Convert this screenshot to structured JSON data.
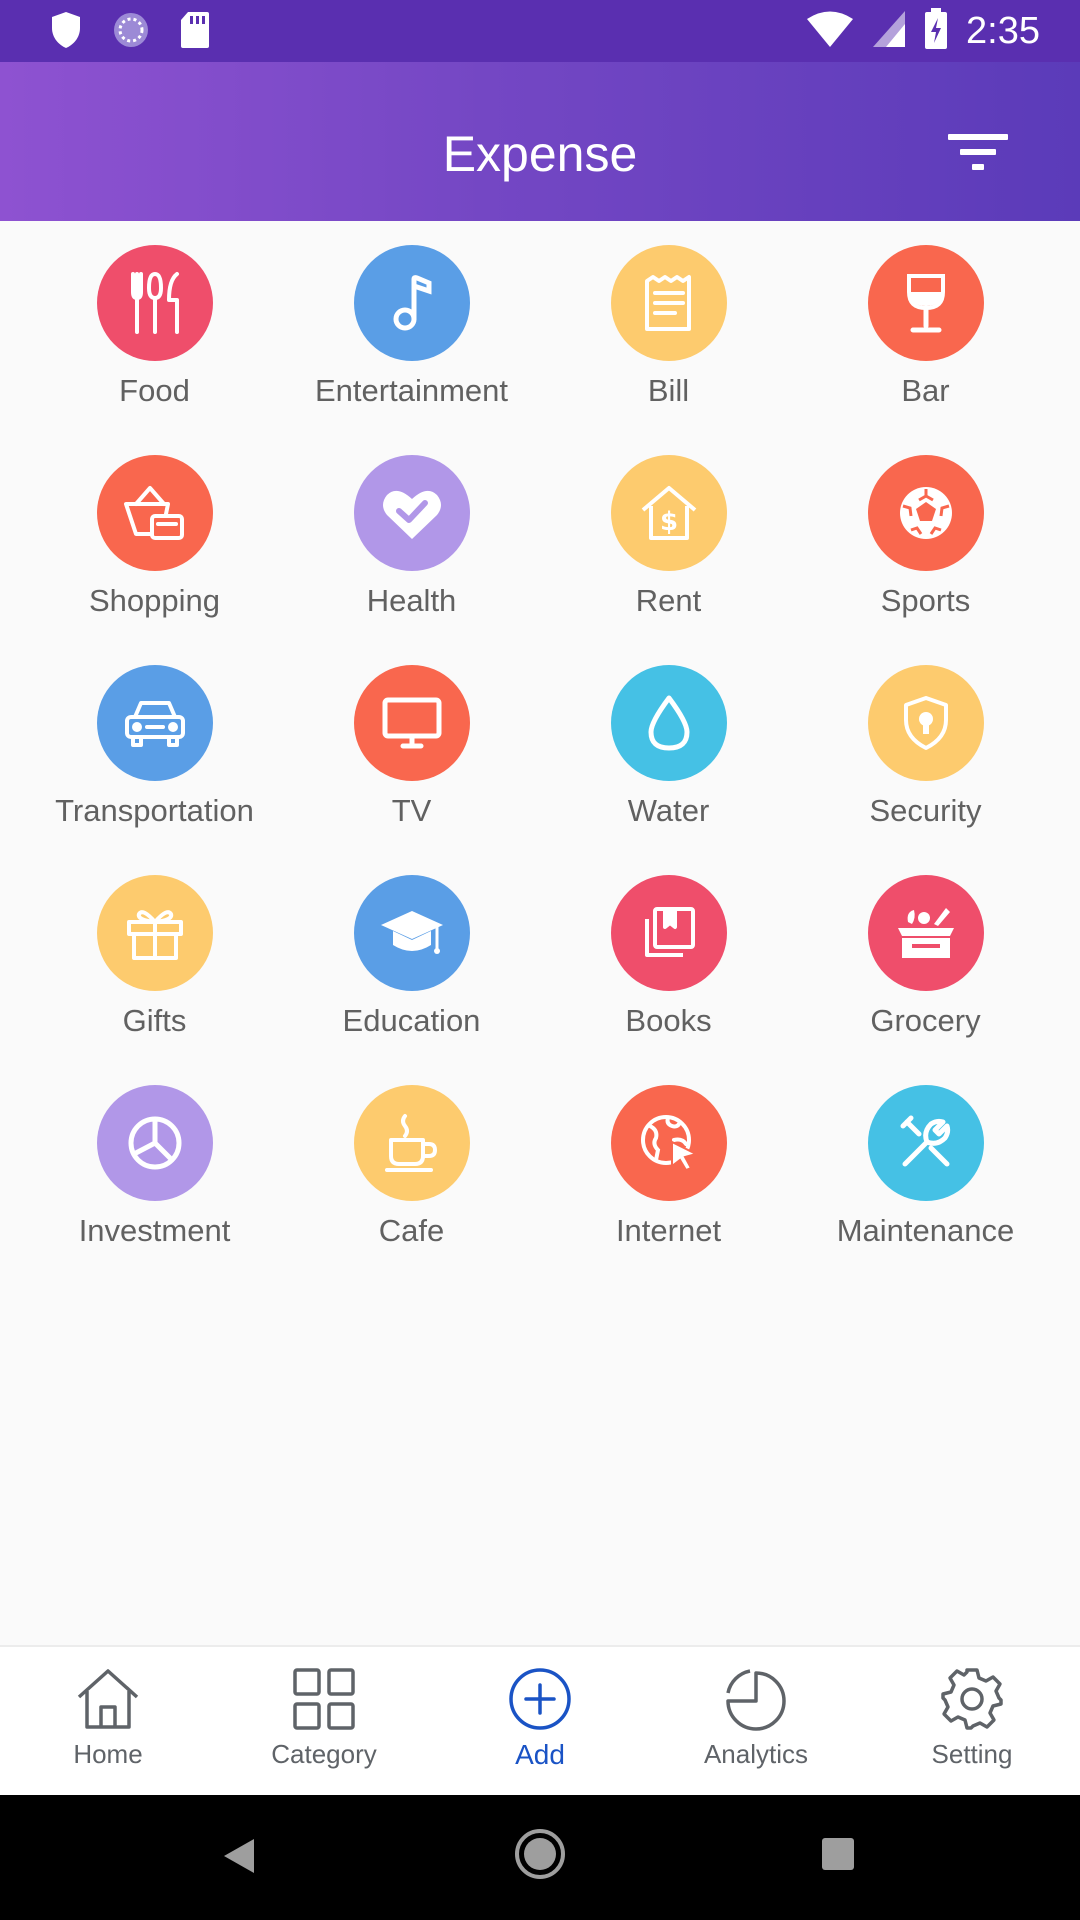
{
  "status_bar": {
    "time": "2:35",
    "left_icons": [
      "shield-icon",
      "loading-icon",
      "sd-card-icon"
    ],
    "right_icons": [
      "wifi-icon",
      "signal-icon",
      "battery-icon"
    ]
  },
  "app_bar": {
    "title": "Expense",
    "filter_icon": "filter-icon"
  },
  "categories": [
    {
      "label": "Food",
      "color": "#ef4e6b",
      "icon": "utensils-icon"
    },
    {
      "label": "Entertainment",
      "color": "#5a9ee6",
      "icon": "music-note-icon"
    },
    {
      "label": "Bill",
      "color": "#fdcb6e",
      "icon": "receipt-icon"
    },
    {
      "label": "Bar",
      "color": "#f9674e",
      "icon": "wine-glass-icon"
    },
    {
      "label": "Shopping",
      "color": "#f9674e",
      "icon": "shopping-basket-icon"
    },
    {
      "label": "Health",
      "color": "#b197e8",
      "icon": "heart-check-icon"
    },
    {
      "label": "Rent",
      "color": "#fdcb6e",
      "icon": "house-dollar-icon"
    },
    {
      "label": "Sports",
      "color": "#f9674e",
      "icon": "soccer-ball-icon"
    },
    {
      "label": "Transportation",
      "color": "#5a9ee6",
      "icon": "car-icon"
    },
    {
      "label": "TV",
      "color": "#f9674e",
      "icon": "tv-icon"
    },
    {
      "label": "Water",
      "color": "#45c1e5",
      "icon": "water-drop-icon"
    },
    {
      "label": "Security",
      "color": "#fdcb6e",
      "icon": "shield-lock-icon"
    },
    {
      "label": "Gifts",
      "color": "#fdcb6e",
      "icon": "gift-icon"
    },
    {
      "label": "Education",
      "color": "#5a9ee6",
      "icon": "graduation-cap-icon"
    },
    {
      "label": "Books",
      "color": "#ef4e6b",
      "icon": "books-icon"
    },
    {
      "label": "Grocery",
      "color": "#ef4e6b",
      "icon": "grocery-box-icon"
    },
    {
      "label": "Investment",
      "color": "#b197e8",
      "icon": "pie-chart-icon"
    },
    {
      "label": "Cafe",
      "color": "#fdcb6e",
      "icon": "coffee-cup-icon"
    },
    {
      "label": "Internet",
      "color": "#f9674e",
      "icon": "globe-cursor-icon"
    },
    {
      "label": "Maintenance",
      "color": "#45c1e5",
      "icon": "tools-icon"
    }
  ],
  "bottom_nav": {
    "items": [
      {
        "label": "Home",
        "icon": "home-icon",
        "active": false
      },
      {
        "label": "Category",
        "icon": "grid-icon",
        "active": false
      },
      {
        "label": "Add",
        "icon": "add-circle-icon",
        "active": true
      },
      {
        "label": "Analytics",
        "icon": "pie-chart-outline-icon",
        "active": false
      },
      {
        "label": "Setting",
        "icon": "gear-icon",
        "active": false
      }
    ],
    "active_color": "#1a53c5"
  },
  "system_nav": {
    "buttons": [
      "back-icon",
      "home-circle-icon",
      "recents-icon"
    ]
  }
}
